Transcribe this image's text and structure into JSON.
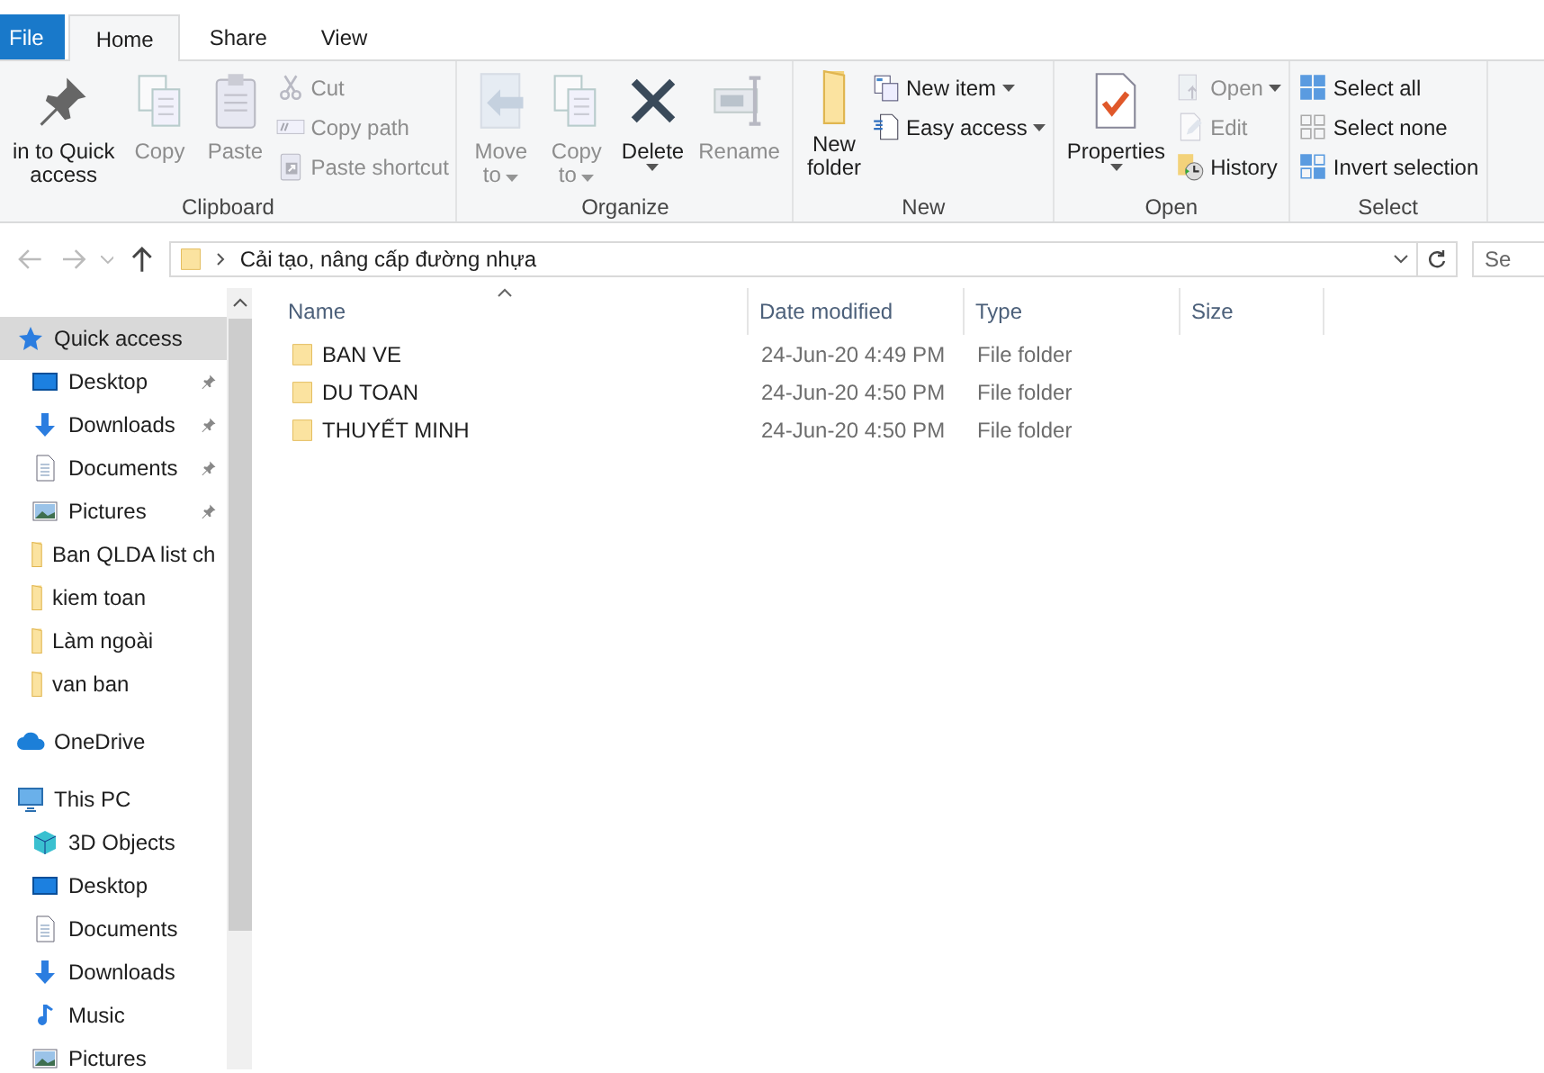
{
  "tabs": [
    {
      "kind": "file",
      "label": "File",
      "selected": false
    },
    {
      "kind": "tab",
      "label": "Home",
      "selected": true
    },
    {
      "kind": "tab",
      "label": "Share",
      "selected": false
    },
    {
      "kind": "tab",
      "label": "View",
      "selected": false
    }
  ],
  "ribbon": {
    "groups": [
      {
        "label": "Clipboard",
        "items": [
          {
            "kind": "large",
            "lines": [
              "in to Quick",
              "access"
            ],
            "disabled": false,
            "dropdown": false
          },
          {
            "kind": "large",
            "lines": [
              "Copy"
            ],
            "disabled": true,
            "dropdown": false
          },
          {
            "kind": "large",
            "lines": [
              "Paste"
            ],
            "disabled": true,
            "dropdown": false
          },
          {
            "kind": "stack",
            "items": [
              {
                "label": "Cut",
                "disabled": true,
                "dropdown": false
              },
              {
                "label": "Copy path",
                "disabled": true,
                "dropdown": false
              },
              {
                "label": "Paste shortcut",
                "disabled": true,
                "dropdown": false
              }
            ]
          }
        ]
      },
      {
        "label": "Organize",
        "items": [
          {
            "kind": "large",
            "lines": [
              "Move",
              "to"
            ],
            "disabled": true,
            "dropdown": true
          },
          {
            "kind": "large",
            "lines": [
              "Copy",
              "to"
            ],
            "disabled": true,
            "dropdown": true
          },
          {
            "kind": "large",
            "lines": [
              "Delete"
            ],
            "disabled": false,
            "dropdown": true
          },
          {
            "kind": "large",
            "lines": [
              "Rename"
            ],
            "disabled": true,
            "dropdown": false
          }
        ]
      },
      {
        "label": "New",
        "items": [
          {
            "kind": "large",
            "lines": [
              "New",
              "folder"
            ],
            "disabled": false,
            "dropdown": false
          },
          {
            "kind": "stack",
            "items": [
              {
                "label": "New item",
                "disabled": false,
                "dropdown": true
              },
              {
                "label": "Easy access",
                "disabled": false,
                "dropdown": true
              }
            ]
          }
        ]
      },
      {
        "label": "Open",
        "items": [
          {
            "kind": "large",
            "lines": [
              "Properties"
            ],
            "disabled": false,
            "dropdown": true
          },
          {
            "kind": "stack",
            "items": [
              {
                "label": "Open",
                "disabled": true,
                "dropdown": true
              },
              {
                "label": "Edit",
                "disabled": true,
                "dropdown": false
              },
              {
                "label": "History",
                "disabled": false,
                "dropdown": false
              }
            ]
          }
        ]
      },
      {
        "label": "Select",
        "items": [
          {
            "kind": "stack",
            "items": [
              {
                "label": "Select all",
                "disabled": false,
                "dropdown": false
              },
              {
                "label": "Select none",
                "disabled": false,
                "dropdown": false
              },
              {
                "label": "Invert selection",
                "disabled": false,
                "dropdown": false
              }
            ]
          }
        ]
      }
    ]
  },
  "address_bar": {
    "breadcrumb": "Cải tạo, nâng cấp đường nhựa"
  },
  "search": {
    "placeholder": "Se"
  },
  "navigation": [
    {
      "label": "Quick access",
      "selected": true,
      "children": [
        {
          "label": "Desktop",
          "selected": false,
          "pinned": true
        },
        {
          "label": "Downloads",
          "selected": false,
          "pinned": true
        },
        {
          "label": "Documents",
          "selected": false,
          "pinned": true
        },
        {
          "label": "Pictures",
          "selected": false,
          "pinned": true
        },
        {
          "label": "Ban QLDA list ch",
          "selected": false,
          "pinned": false
        },
        {
          "label": "kiem toan",
          "selected": false,
          "pinned": false
        },
        {
          "label": "Làm ngoài",
          "selected": false,
          "pinned": false
        },
        {
          "label": "van ban",
          "selected": false,
          "pinned": false
        }
      ]
    },
    {
      "label": "OneDrive",
      "selected": false
    },
    {
      "label": "This PC",
      "selected": false,
      "children": [
        {
          "label": "3D Objects",
          "selected": false
        },
        {
          "label": "Desktop",
          "selected": false
        },
        {
          "label": "Documents",
          "selected": false
        },
        {
          "label": "Downloads",
          "selected": false
        },
        {
          "label": "Music",
          "selected": false
        },
        {
          "label": "Pictures",
          "selected": false
        }
      ]
    }
  ],
  "file_list": {
    "columns": [
      "Name",
      "Date modified",
      "Type",
      "Size"
    ],
    "rows": [
      {
        "name": "BAN VE",
        "date_modified": "24-Jun-20 4:49 PM",
        "type": "File folder",
        "selected": false
      },
      {
        "name": "DU TOAN",
        "date_modified": "24-Jun-20 4:50 PM",
        "type": "File folder",
        "selected": false
      },
      {
        "name": "THUYẾT MINH",
        "date_modified": "24-Jun-20 4:50 PM",
        "type": "File folder",
        "selected": false
      }
    ]
  }
}
